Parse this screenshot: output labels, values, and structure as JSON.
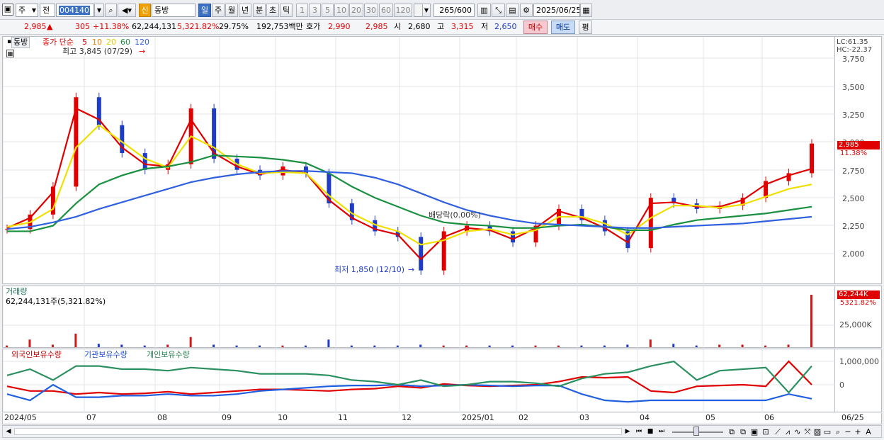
{
  "toolbar": {
    "market": "주",
    "period_type": "전",
    "code": "004140",
    "badge": "신",
    "stock_name": "동방",
    "periods": [
      "일",
      "주",
      "월",
      "년",
      "분",
      "초",
      "틱"
    ],
    "intervals": [
      "1",
      "3",
      "5",
      "10",
      "20",
      "30",
      "60",
      "120"
    ],
    "count": "265",
    "count_total": "/600",
    "date": "2025/06/25"
  },
  "quote": {
    "price": "2,985",
    "arrow": "▲",
    "change": "305",
    "change_pct": "+11.38%",
    "volume": "62,244,131",
    "vol_ratio": "5,321.82%",
    "turnover": "29.75%",
    "amount": "192,753백만",
    "hoga_label": "호가",
    "ask": "2,990",
    "bid": "2,985",
    "open_label": "시",
    "open": "2,680",
    "high_label": "고",
    "high": "3,315",
    "low_label": "저",
    "low": "2,650",
    "buy": "매수",
    "sell": "매도",
    "eval": "평"
  },
  "price_pane": {
    "name": "동방",
    "ma_label": "종가 단순",
    "ma_periods": [
      "5",
      "10",
      "20",
      "60",
      "120"
    ],
    "ma_colors": [
      "#e00000",
      "#f08000",
      "#f0e000",
      "#1a9040",
      "#3060e0"
    ],
    "high_note": "최고 3,845 (07/29)",
    "low_note": "최저 1,850 (12/10)",
    "div_note": "배당락(0.00%)",
    "lc": "LC:61.35",
    "hc": "HC:-22.37",
    "price_tag": "2,985",
    "pct_tag": "11.38%",
    "yticks": [
      "3,750",
      "3,500",
      "3,250",
      "3,000",
      "2,750",
      "2,500",
      "2,250",
      "2,000"
    ]
  },
  "volume_pane": {
    "title": "거래량",
    "info": "62,244,131주(5,321.82%)",
    "tag": "62,244K",
    "pct": "5321.82%",
    "ytick": "25,000K"
  },
  "holding_pane": {
    "titles": [
      "외국인보유수량",
      "기관보유수량",
      "개인보유수량"
    ],
    "colors": [
      "#e00000",
      "#2060e0",
      "#2a9060"
    ],
    "yticks": [
      "1,000,000",
      "0"
    ]
  },
  "x_labels": [
    "2024/05",
    "07",
    "08",
    "09",
    "10",
    "11",
    "12",
    "2025/01",
    "02",
    "03",
    "04",
    "05",
    "06",
    "06/25"
  ],
  "chart_data": {
    "type": "candlestick",
    "title": "동방",
    "x": [
      "2024/05",
      "07",
      "08",
      "09",
      "10",
      "11",
      "12",
      "2025/01",
      "02",
      "03",
      "04",
      "05",
      "06",
      "06/25"
    ],
    "series": [
      {
        "name": "종가",
        "values": [
          2220,
          2350,
          2600,
          3400,
          3150,
          2900,
          2750,
          2800,
          3300,
          2850,
          2750,
          2700,
          2780,
          2720,
          2450,
          2300,
          2200,
          2150,
          1850,
          2200,
          2250,
          2200,
          2100,
          2250,
          2400,
          2300,
          2200,
          2050,
          2500,
          2450,
          2400,
          2430,
          2500,
          2650,
          2720,
          2985
        ]
      },
      {
        "name": "5",
        "values": [
          2230,
          2320,
          2550,
          3300,
          3200,
          2950,
          2800,
          2780,
          3200,
          2900,
          2780,
          2710,
          2750,
          2720,
          2480,
          2320,
          2220,
          2170,
          1950,
          2150,
          2230,
          2210,
          2130,
          2230,
          2380,
          2320,
          2230,
          2100,
          2450,
          2460,
          2420,
          2420,
          2480,
          2620,
          2700,
          2760
        ]
      },
      {
        "name": "20",
        "values": [
          2240,
          2280,
          2400,
          2950,
          3150,
          3000,
          2850,
          2770,
          3050,
          2950,
          2800,
          2720,
          2730,
          2720,
          2520,
          2360,
          2260,
          2200,
          2080,
          2120,
          2200,
          2220,
          2170,
          2210,
          2330,
          2330,
          2270,
          2170,
          2320,
          2430,
          2430,
          2410,
          2440,
          2510,
          2580,
          2620
        ]
      },
      {
        "name": "60",
        "values": [
          2200,
          2200,
          2250,
          2450,
          2620,
          2700,
          2760,
          2780,
          2820,
          2880,
          2870,
          2860,
          2840,
          2810,
          2720,
          2600,
          2500,
          2420,
          2340,
          2280,
          2260,
          2250,
          2230,
          2230,
          2250,
          2260,
          2240,
          2210,
          2210,
          2260,
          2300,
          2320,
          2340,
          2360,
          2390,
          2420
        ]
      },
      {
        "name": "120",
        "values": [
          2220,
          2240,
          2280,
          2330,
          2400,
          2460,
          2520,
          2580,
          2640,
          2680,
          2710,
          2730,
          2740,
          2740,
          2730,
          2720,
          2680,
          2620,
          2540,
          2460,
          2390,
          2340,
          2300,
          2270,
          2260,
          2250,
          2240,
          2230,
          2230,
          2240,
          2250,
          2260,
          2270,
          2290,
          2310,
          2330
        ]
      }
    ],
    "volume": [
      2,
      9,
      3,
      16,
      4,
      3,
      2,
      3,
      12,
      3,
      2,
      2,
      2,
      2,
      9,
      2,
      2,
      2,
      3,
      2,
      2,
      2,
      2,
      2,
      2,
      2,
      2,
      3,
      9,
      4,
      2,
      3,
      3,
      2,
      3,
      62
    ],
    "volume_unit": "K shares x1000",
    "holdings": [
      {
        "name": "외국인보유수량",
        "values": [
          -10,
          -40,
          -40,
          -60,
          -50,
          -60,
          -55,
          -45,
          -60,
          -50,
          -40,
          -30,
          -30,
          -35,
          -40,
          -30,
          -25,
          -10,
          -20,
          5,
          -5,
          -10,
          -5,
          0,
          20,
          50,
          45,
          50,
          -40,
          -50,
          -10,
          -5,
          0,
          -10,
          150,
          0
        ]
      },
      {
        "name": "기관보유수량",
        "values": [
          -60,
          -100,
          0,
          -80,
          -80,
          -70,
          -70,
          -60,
          -70,
          -70,
          -60,
          -40,
          -30,
          -20,
          -10,
          -5,
          -5,
          0,
          -10,
          -5,
          0,
          -5,
          -10,
          -5,
          -5,
          -60,
          -100,
          -110,
          -100,
          -100,
          -100,
          -100,
          -100,
          -100,
          -60,
          -90
        ]
      },
      {
        "name": "개인보유수량",
        "values": [
          60,
          100,
          30,
          120,
          120,
          100,
          100,
          90,
          110,
          100,
          90,
          70,
          70,
          70,
          60,
          30,
          20,
          0,
          30,
          -10,
          0,
          20,
          20,
          10,
          -10,
          40,
          70,
          80,
          120,
          150,
          30,
          90,
          100,
          110,
          -50,
          120
        ]
      }
    ]
  }
}
